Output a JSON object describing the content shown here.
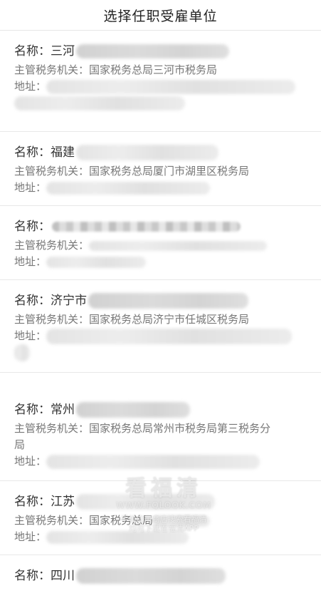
{
  "header": {
    "title": "选择任职受雇单位"
  },
  "labels": {
    "name": "名称：",
    "authority": "主管税务机关：",
    "address": "地址："
  },
  "items": [
    {
      "name": "三河",
      "authority": "国家税务总局三河市税务局"
    },
    {
      "name": "福建",
      "authority": "国家税务总局厦门市湖里区税务局"
    },
    {
      "name": "",
      "authority": ""
    },
    {
      "name": "济宁市",
      "authority": "国家税务总局济宁市任城区税务局"
    },
    {
      "name": "常州",
      "authority_line1": "国家税务总局常州市税务局第三税务分",
      "authority_line2": "局"
    },
    {
      "name": "江苏",
      "authority": "国家税务总局"
    },
    {
      "name": "四川"
    }
  ],
  "watermark": {
    "brand": "看福清",
    "url": "WWW.FQLOOK.COM",
    "line1": "手机应用商店搜索看福清",
    "line2": "均可下载看福清APP"
  }
}
